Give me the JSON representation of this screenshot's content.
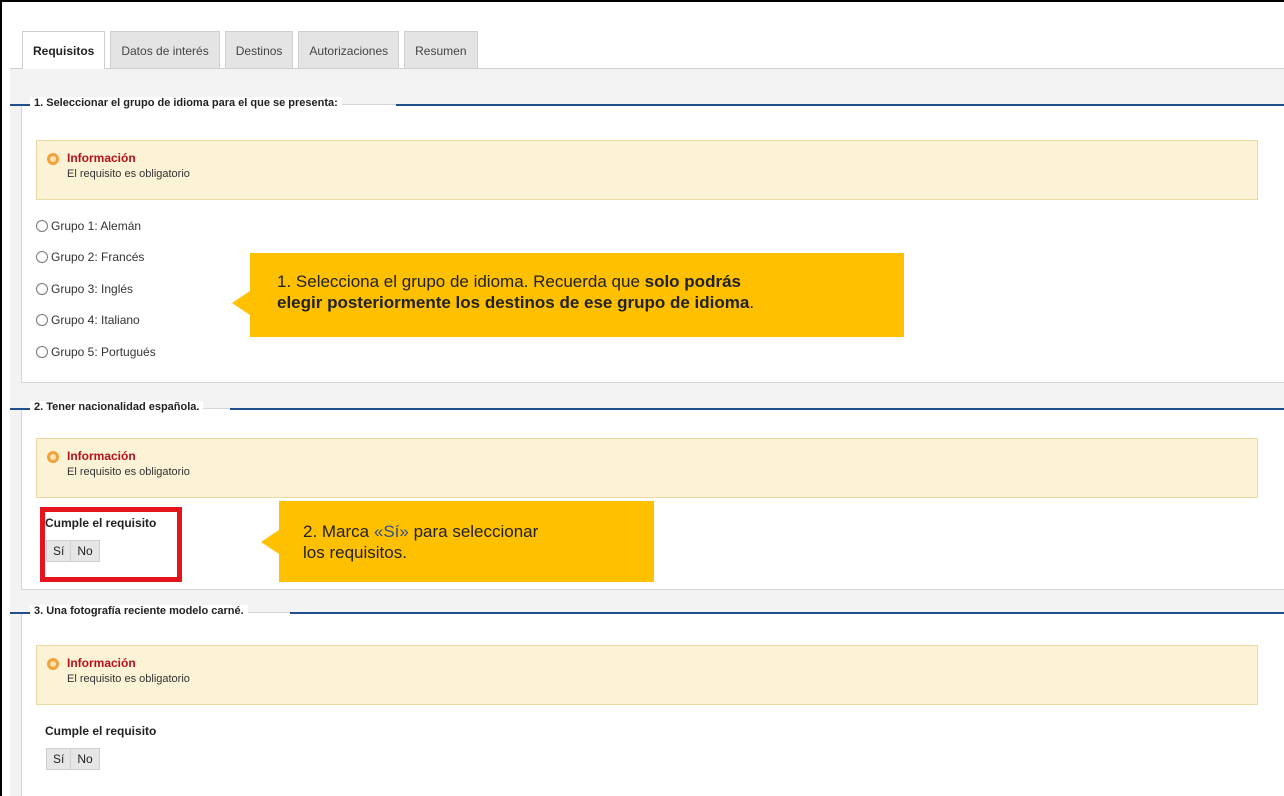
{
  "tabs": [
    {
      "label": "Requisitos",
      "active": true
    },
    {
      "label": "Datos de interés",
      "active": false
    },
    {
      "label": "Destinos",
      "active": false
    },
    {
      "label": "Autorizaciones",
      "active": false
    },
    {
      "label": "Resumen",
      "active": false
    }
  ],
  "sections": [
    {
      "legend": "1. Seleccionar el grupo de idioma para el que se presenta:",
      "info_title": "Información",
      "info_text": "El requisito es obligatorio",
      "options": [
        "Grupo 1: Alemán",
        "Grupo 2: Francés",
        "Grupo 3: Inglés",
        "Grupo 4: Italiano",
        "Grupo 5: Portugués"
      ]
    },
    {
      "legend": "2. Tener nacionalidad española.",
      "info_title": "Información",
      "info_text": "El requisito es obligatorio",
      "req_label": "Cumple el requisito",
      "yes_label": "Sí",
      "no_label": "No"
    },
    {
      "legend": "3. Una fotografía reciente modelo carné.",
      "info_title": "Información",
      "info_text": "El requisito es obligatorio",
      "req_label": "Cumple el requisito",
      "yes_label": "Sí",
      "no_label": "No"
    }
  ],
  "callouts": {
    "first": {
      "line1_pre": "1. Selecciona el grupo de idioma. Recuerda que ",
      "line1_bold": "solo podrás",
      "line2_bold": "elegir posteriormente los destinos de ese grupo de idioma",
      "line2_end": "."
    },
    "second": {
      "pre": "2. Marca ",
      "accent": "«Sí»",
      "post": " para seleccionar",
      "line2": "los requisitos."
    }
  },
  "colors": {
    "callout": "#ffc000",
    "highlight_border": "#e3141b",
    "legend_line": "#1f4f8f",
    "info_background": "#fcf2d6",
    "info_title": "#b5121b"
  }
}
